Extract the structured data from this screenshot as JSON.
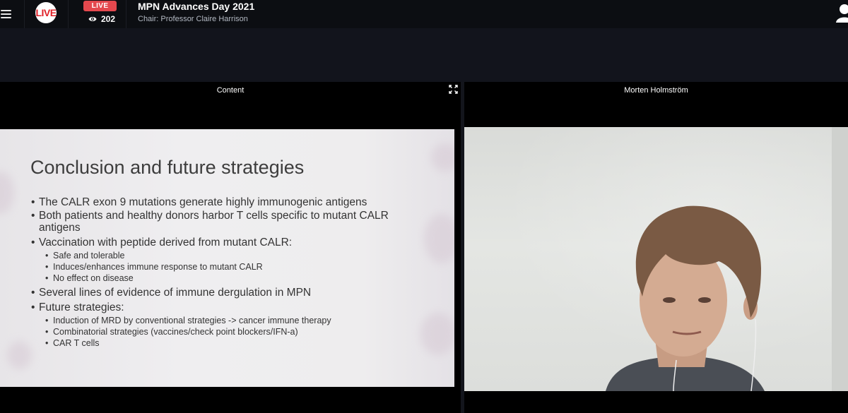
{
  "header": {
    "logo_text": "LIVE",
    "live_badge": "LIVE",
    "viewer_count": "202",
    "title": "MPN Advances Day 2021",
    "subtitle": "Chair: Professor Claire Harrison"
  },
  "panels": {
    "content_label": "Content",
    "speaker_name": "Morten Holmström"
  },
  "slide": {
    "title": "Conclusion and future strategies",
    "bullets": [
      "The CALR exon 9 mutations generate highly immunogenic antigens",
      "Both patients and healthy donors harbor T cells specific to mutant CALR antigens",
      "Vaccination with peptide derived from mutant CALR:",
      "Several lines of evidence of immune dergulation in MPN",
      "Future strategies:"
    ],
    "sub_vaccination": [
      "Safe and tolerable",
      "Induces/enhances immune response to mutant CALR",
      "No effect on disease"
    ],
    "sub_future": [
      "Induction of MRD by conventional strategies -> cancer immune therapy",
      "Combinatorial strategies (vaccines/check point blockers/IFN-a)",
      "CAR T cells"
    ]
  },
  "icons": {
    "menu": "hamburger-menu-icon",
    "viewers": "eye-icon",
    "expand": "expand-icon",
    "user": "user-icon"
  },
  "colors": {
    "live_red": "#e4484e",
    "logo_red": "#e02027",
    "header_bg": "#0c0e12"
  }
}
